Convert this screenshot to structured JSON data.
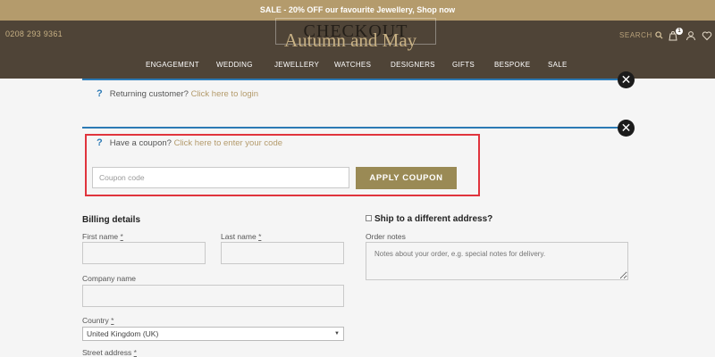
{
  "promo": {
    "text": "SALE - 20% OFF our favourite Jewellery, Shop now"
  },
  "header": {
    "phone": "0208 293 9361",
    "page_title": "CHECKOUT",
    "logo": "Autumn and May",
    "search_label": "SEARCH",
    "cart_count": "1"
  },
  "nav": {
    "items": [
      "ENGAGEMENT",
      "WEDDING",
      "JEWELLERY",
      "WATCHES",
      "DESIGNERS",
      "GIFTS",
      "BESPOKE",
      "SALE"
    ]
  },
  "login_notice": {
    "text": "Returning customer?",
    "link": "Click here to login"
  },
  "coupon_notice": {
    "text": "Have a coupon?",
    "link": "Click here to enter your code"
  },
  "coupon": {
    "placeholder": "Coupon code",
    "button": "APPLY COUPON"
  },
  "billing": {
    "heading": "Billing details",
    "first_name": "First name",
    "last_name": "Last name",
    "company": "Company name",
    "country": "Country",
    "country_value": "United Kingdom (UK)",
    "street": "Street address",
    "required_mark": "*"
  },
  "shipping": {
    "heading": "Ship to a different address?",
    "notes_label": "Order notes",
    "notes_placeholder": "Notes about your order, e.g. special notes for delivery."
  },
  "colors": {
    "header_bg": "#4f4437",
    "promo_bg": "#b49b6c",
    "accent_gold": "#b49b6c",
    "button": "#9a8a55",
    "info_blue": "#2c7ab5",
    "highlight_red": "#e0343d"
  }
}
